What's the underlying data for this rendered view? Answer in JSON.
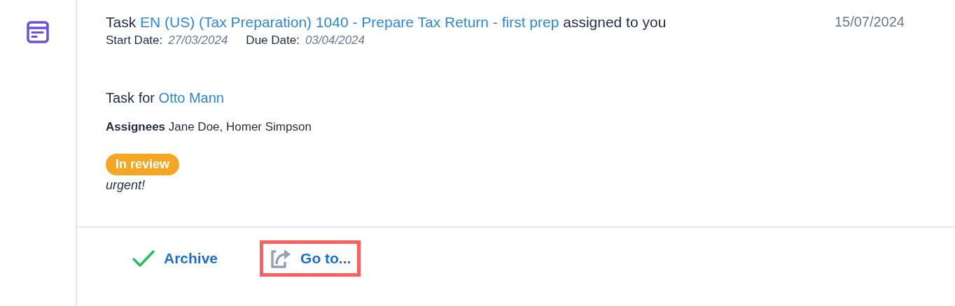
{
  "notification": {
    "title_prefix": "Task",
    "title_link": "EN (US) (Tax Preparation) 1040 - Prepare Tax Return - first prep",
    "title_suffix": "assigned to you",
    "date": "15/07/2024",
    "start_label": "Start Date:",
    "start_date": "27/03/2024",
    "due_label": "Due Date:",
    "due_date": "03/04/2024",
    "client_prefix": "Task for",
    "client_link": "Otto Mann",
    "assignees_label": "Assignees",
    "assignees": "Jane Doe, Homer Simpson",
    "status": {
      "label": "In review",
      "color": "#f5a623"
    },
    "note": "urgent!"
  },
  "actions": [
    {
      "kind": "archive",
      "label": "Archive",
      "highlighted": false
    },
    {
      "kind": "goto",
      "label": "Go to...",
      "highlighted": true
    }
  ]
}
